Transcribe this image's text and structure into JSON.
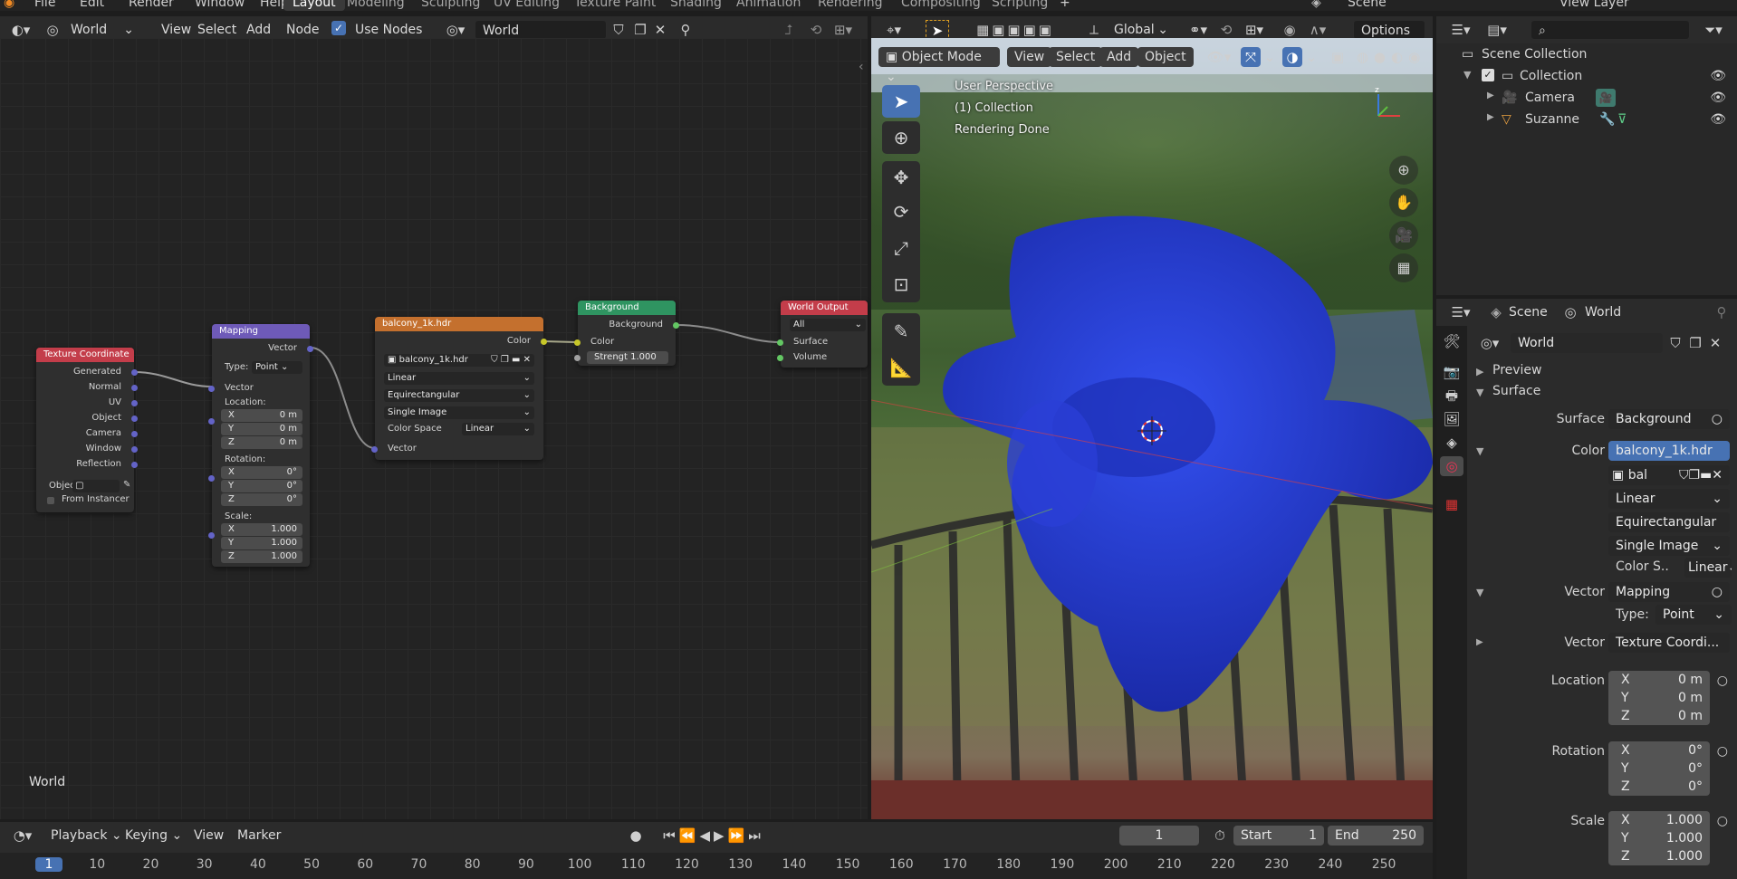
{
  "menu": [
    "File",
    "Edit",
    "Render",
    "Window",
    "Help"
  ],
  "workspaces": [
    "Layout",
    "Modeling",
    "Sculpting",
    "UV Editing",
    "Texture Paint",
    "Shading",
    "Animation",
    "Rendering",
    "Compositing",
    "Scripting"
  ],
  "active_workspace": "Layout",
  "scene_name": "Scene",
  "view_layer": "View Layer",
  "node_editor": {
    "type_label": "World",
    "menus": [
      "View",
      "Select",
      "Add",
      "Node"
    ],
    "use_nodes_label": "Use Nodes",
    "world_name": "World",
    "corner_label": "World"
  },
  "nodes": {
    "texcoord": {
      "title": "Texture Coordinate",
      "outputs": [
        "Generated",
        "Normal",
        "UV",
        "Object",
        "Camera",
        "Window",
        "Reflection"
      ],
      "object_label": "Objec",
      "from_instancer": "From Instancer"
    },
    "mapping": {
      "title": "Mapping",
      "output": "Vector",
      "type_label": "Type:",
      "type_value": "Point",
      "vector": "Vector",
      "location": "Location:",
      "rotation": "Rotation:",
      "scale": "Scale:",
      "loc": [
        [
          "X",
          "0 m"
        ],
        [
          "Y",
          "0 m"
        ],
        [
          "Z",
          "0 m"
        ]
      ],
      "rot": [
        [
          "X",
          "0°"
        ],
        [
          "Y",
          "0°"
        ],
        [
          "Z",
          "0°"
        ]
      ],
      "scl": [
        [
          "X",
          "1.000"
        ],
        [
          "Y",
          "1.000"
        ],
        [
          "Z",
          "1.000"
        ]
      ]
    },
    "envtex": {
      "title": "balcony_1k.hdr",
      "output": "Color",
      "image": "balcony_1k.hdr",
      "interp": "Linear",
      "proj": "Equirectangular",
      "source": "Single Image",
      "cs_label": "Color Space",
      "cs_value": "Linear",
      "input": "Vector"
    },
    "background": {
      "title": "Background",
      "output": "Background",
      "color": "Color",
      "strength_label": "Strengt",
      "strength_value": "1.000"
    },
    "output": {
      "title": "World Output",
      "target": "All",
      "surface": "Surface",
      "volume": "Volume"
    }
  },
  "viewport": {
    "mode": "Object Mode",
    "menus": [
      "View",
      "Select",
      "Add",
      "Object"
    ],
    "orientation": "Global",
    "options": "Options",
    "overlay_lines": [
      "User Perspective",
      "(1) Collection",
      "Rendering Done"
    ]
  },
  "outliner": {
    "root": "Scene Collection",
    "collection": "Collection",
    "items": [
      "Camera",
      "Suzanne"
    ]
  },
  "properties": {
    "breadcrumb_scene": "Scene",
    "breadcrumb_world": "World",
    "world_name": "World",
    "panel_preview": "Preview",
    "panel_surface": "Surface",
    "surface_label": "Surface",
    "surface_value": "Background",
    "color_label": "Color",
    "color_value": "balcony_1k.hdr",
    "image_short": "bal",
    "interp": "Linear",
    "proj": "Equirectangular",
    "source": "Single Image",
    "cs_label": "Color S..",
    "cs_value": "Linear",
    "vector_label": "Vector",
    "vector_value": "Mapping",
    "type_label": "Type:",
    "type_value": "Point",
    "vector2_label": "Vector",
    "vector2_value": "Texture Coordi...",
    "location_label": "Location",
    "rotation_label": "Rotation",
    "scale_label": "Scale",
    "loc": [
      [
        "X",
        "0 m"
      ],
      [
        "Y",
        "0 m"
      ],
      [
        "Z",
        "0 m"
      ]
    ],
    "rot": [
      [
        "X",
        "0°"
      ],
      [
        "Y",
        "0°"
      ],
      [
        "Z",
        "0°"
      ]
    ],
    "scl": [
      [
        "X",
        "1.000"
      ],
      [
        "Y",
        "1.000"
      ],
      [
        "Z",
        "1.000"
      ]
    ]
  },
  "timeline": {
    "menus": [
      "Playback",
      "Keying",
      "View",
      "Marker"
    ],
    "current_frame": "1",
    "start_label": "Start",
    "start_value": "1",
    "end_label": "End",
    "end_value": "250",
    "ticks": [
      "1",
      "10",
      "20",
      "30",
      "40",
      "50",
      "60",
      "70",
      "80",
      "90",
      "100",
      "110",
      "120",
      "130",
      "140",
      "150",
      "160",
      "170",
      "180",
      "190",
      "200",
      "210",
      "220",
      "230",
      "240",
      "250"
    ]
  },
  "colors": {
    "accent_blue": "#4772b3",
    "node_texcoord": "#c33d4a",
    "node_mapping": "#6e5ab8",
    "node_envtex": "#c4702e",
    "node_background": "#2f9461",
    "node_output": "#c33d4a",
    "suzanne": "#2438d4"
  }
}
